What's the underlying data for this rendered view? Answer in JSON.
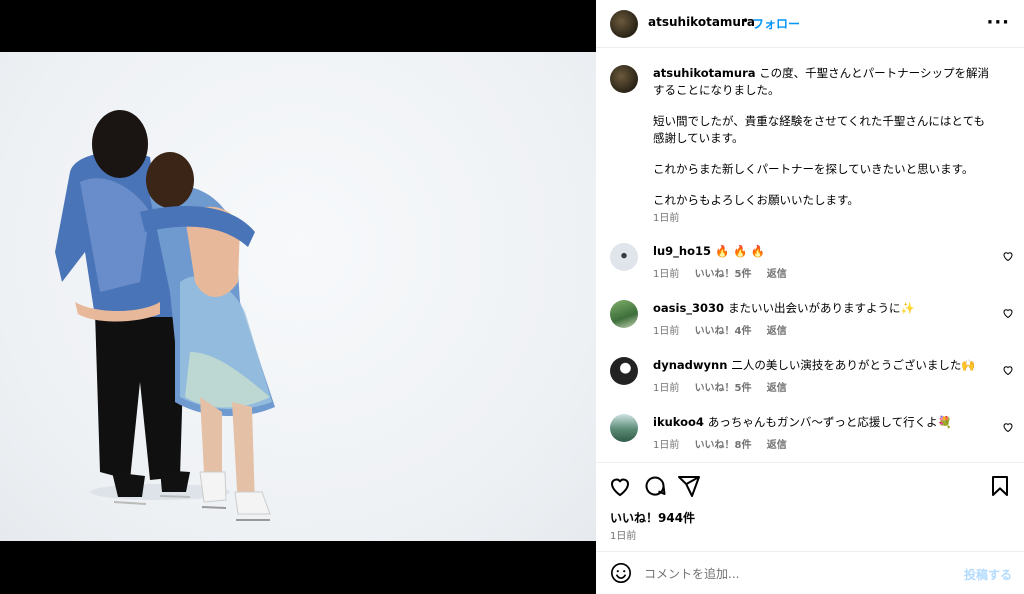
{
  "header": {
    "username": "atsuhikotamura",
    "separator": "•",
    "follow_label": "フォロー",
    "more_label": "···"
  },
  "caption": {
    "username": "atsuhikotamura",
    "line1": "この度、千聖さんとパートナーシップを解消することになりました。",
    "para2": "短い間でしたが、貴重な経験をさせてくれた千聖さんにはとても感謝しています。",
    "para3": "これからまた新しくパートナーを探していきたいと思います。",
    "para4": "これからもよろしくお願いいたします。",
    "time": "1日前"
  },
  "comments": [
    {
      "username": "lu9_ho15",
      "text": "🔥 🔥 🔥",
      "time": "1日前",
      "likes": "いいね！5件",
      "reply": "返信"
    },
    {
      "username": "oasis_3030",
      "text": "またいい出会いがありますように✨",
      "time": "1日前",
      "likes": "いいね！4件",
      "reply": "返信"
    },
    {
      "username": "dynadwynn",
      "text": "二人の美しい演技をありがとうございました🙌",
      "time": "1日前",
      "likes": "いいね！5件",
      "reply": "返信"
    },
    {
      "username": "ikukoo4",
      "text": "あっちゃんもガンバ〜ずっと応援して行くよ💐",
      "time": "1日前",
      "likes": "いいね！8件",
      "reply": "返信"
    }
  ],
  "actions": {
    "likes": "いいね！944件",
    "time": "1日前"
  },
  "comment_box": {
    "placeholder": "コメントを追加...",
    "post_label": "投稿する"
  },
  "icons": [
    "heart-icon",
    "comment-icon",
    "share-icon",
    "bookmark-icon",
    "emoji-icon",
    "more-icon"
  ]
}
